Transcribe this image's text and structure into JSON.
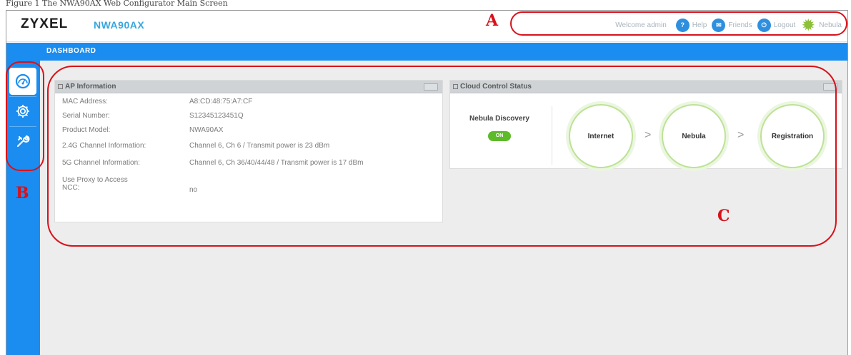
{
  "caption": "Figure 1    The NWA90AX Web Configurator Main Screen",
  "header": {
    "brand": "ZYXEL",
    "model": "NWA90AX",
    "welcome": "Welcome admin",
    "links": [
      {
        "label": "Help",
        "icon": "help-icon",
        "glyph": "?"
      },
      {
        "label": "Friends",
        "icon": "friends-icon",
        "glyph": "✉"
      },
      {
        "label": "Logout",
        "icon": "logout-icon",
        "glyph": "⏻"
      },
      {
        "label": "Nebula",
        "icon": "nebula-icon",
        "glyph": "✹"
      }
    ]
  },
  "navbar": {
    "tab": "DASHBOARD"
  },
  "sidebar": {
    "items": [
      {
        "name": "dashboard",
        "icon": "dashboard-gauge-icon",
        "active": true
      },
      {
        "name": "configuration",
        "icon": "gear-icon",
        "active": false
      },
      {
        "name": "maintenance",
        "icon": "maintenance-icon",
        "active": false
      }
    ]
  },
  "ap_info": {
    "title": "AP Information",
    "rows": [
      {
        "label": "MAC Address:",
        "value": "A8:CD:48:75:A7:CF"
      },
      {
        "label": "Serial Number:",
        "value": "S12345123451Q"
      },
      {
        "label": "Product Model:",
        "value": "NWA90AX"
      },
      {
        "label": "2.4G Channel Information:",
        "value": "Channel 6, Ch 6 / Transmit power is 23 dBm"
      },
      {
        "label": "5G Channel Information:",
        "value": "Channel 6, Ch 36/40/44/48 / Transmit power is 17 dBm"
      },
      {
        "label": "Use Proxy to Access NCC:",
        "value": "no"
      }
    ]
  },
  "cloud": {
    "title": "Cloud Control Status",
    "discovery_label": "Nebula Discovery",
    "discovery_state": "ON",
    "steps": [
      "Internet",
      "Nebula",
      "Registration"
    ],
    "arrow": ">"
  },
  "annotations": {
    "a": "A",
    "b": "B",
    "c": "C"
  },
  "colors": {
    "accent_blue": "#1b8df0",
    "annotation_red": "#d8111a",
    "status_green": "#5dbb2a"
  }
}
